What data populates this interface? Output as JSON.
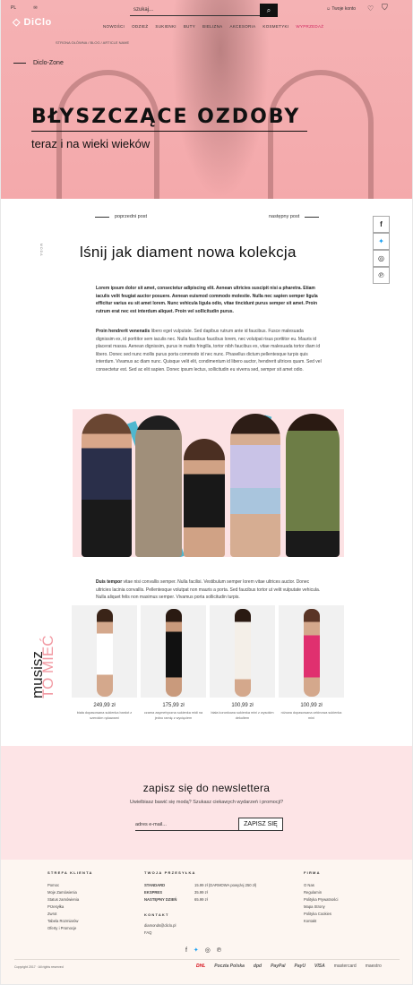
{
  "header": {
    "lang": "PL",
    "logo": "DiClo",
    "search_placeholder": "szukaj...",
    "account": "Twoje konto",
    "nav": [
      "NOWOŚCI",
      "ODZIEŻ",
      "SUKIENKI",
      "BUTY",
      "BIELIZNA",
      "AKCESORIA",
      "KOSMETYKI",
      "WYPRZEDAŻ"
    ],
    "breadcrumb": "STRONA GŁÓWNA  /  BLOG  /  ARTICLE NAME"
  },
  "hero": {
    "back_label": "Diclo-Zone",
    "title": "BŁYSZCZĄCE OZDOBY",
    "subtitle": "teraz i na wieki wieków"
  },
  "post": {
    "prev": "poprzedni post",
    "next": "następny post",
    "tag": "MODA",
    "title": "lśnij jak diament nowa kolekcja",
    "p1": "Lorem ipsum dolor sit amet, consectetur adipiscing elit. Aenean ultricies suscipit nisi a pharetra. Etiam iaculis velit feugiat auctor posuere. Aenean euismod commodo molestie. Nulla nec sapien semper ligula efficitur varius eu sit amet lorem. Nunc vehicula ligula odio, vitae tincidunt purus semper sit amet. Proin rutrum erat nec est interdum aliquet. Proin vel sollicitudin purus.",
    "p2_lead": "Proin hendrerit venenatis",
    "p2": " libero eget vulputate. Sed dapibus rutrum ante id faucibus. Fusce malesuada dignissim ex, id porttitor sem iaculis nec. Nulla faucibus faucibus lorem, nec volutpat risus porttitor eu. Mauris id placerat massa. Aenean dignissim, purus in mattis fringilla, tortor nibh faucibus ex, vitae malesuada tortor diam id libero. Donec sed nunc mollis purus porta commodo id nec nunc. Phasellus dictum pellentesque turpis quis interdum. Vivamus ac diam nunc. Quisque velit elit, condimentum id libero auctor, hendrerit ultrices quam. Sed vel consectetur est. Sed ac elit sapien. Donec ipsum lectus, sollicitudin eu viverra sed, semper sit amet odio.",
    "p3_lead": "Duis tempor",
    "p3": " vitae nisi convallis semper. Nulla facilisi. Vestibulum semper lorem vitae ultrices auctor. Donec ultricies lacinia convallis. Pellentesque volutpat non mauris a porta. Sed faucibus tortor ut velit vulputate vehicula. Nulla aliquet felis non maximus semper. Vivamus porta sollicitudin turpis."
  },
  "must": {
    "word1": "musisz",
    "word2": "TO MIEĆ"
  },
  "products": [
    {
      "price": "249,99 zł",
      "name": "biała dopasowana sukienka bardot z szerokim rękawami"
    },
    {
      "price": "175,99 zł",
      "name": "czarna asymetryczna sukienka midi na jedno ramię z wycięciem"
    },
    {
      "price": "100,99 zł",
      "name": "biała koronkowa sukienka mini z wysokim dekoltem"
    },
    {
      "price": "100,99 zł",
      "name": "różowa dopasowana cekinowa sukienka mini"
    }
  ],
  "newsletter": {
    "title": "zapisz się do newslettera",
    "subtitle": "Uwielbiasz bawić się modą? Szukasz ciekawych wydarzeń i promocji?",
    "placeholder": "adres e-mail...",
    "button": "ZAPISZ SIĘ"
  },
  "footer": {
    "col1_title": "STREFA KLIENTA",
    "col1": [
      "Pomoc",
      "Moje Zamówienia",
      "Status zamówienia",
      "Przesyłka",
      "Zwrot",
      "Tabela Rozmiarów",
      "Oferty i Promocje"
    ],
    "col2_title": "TWOJA PRZESYŁKA",
    "ship": [
      {
        "k": "STANDARD",
        "v": "15.99 zł (DARMOWA powyżej 250 zł)"
      },
      {
        "k": "EKSPRES",
        "v": "35.99 zł"
      },
      {
        "k": "NASTĘPNY DZIEŃ",
        "v": "65.99 zł"
      }
    ],
    "contact_title": "KONTAKT",
    "email": "diamonds@diclo.pl",
    "faq": "FAQ",
    "col3_title": "FIRMA",
    "col3": [
      "O Nas",
      "Regulamin",
      "Polityka Prywatności",
      "Mapa Strony",
      "Polityka Cookies",
      "Kontakt"
    ],
    "copyright": "Copyright 2017 · All rights reserved",
    "payments": [
      "DHL",
      "Poczta Polska",
      "dpd",
      "PayPal",
      "PayU",
      "VISA",
      "mastercard",
      "maestro"
    ]
  }
}
